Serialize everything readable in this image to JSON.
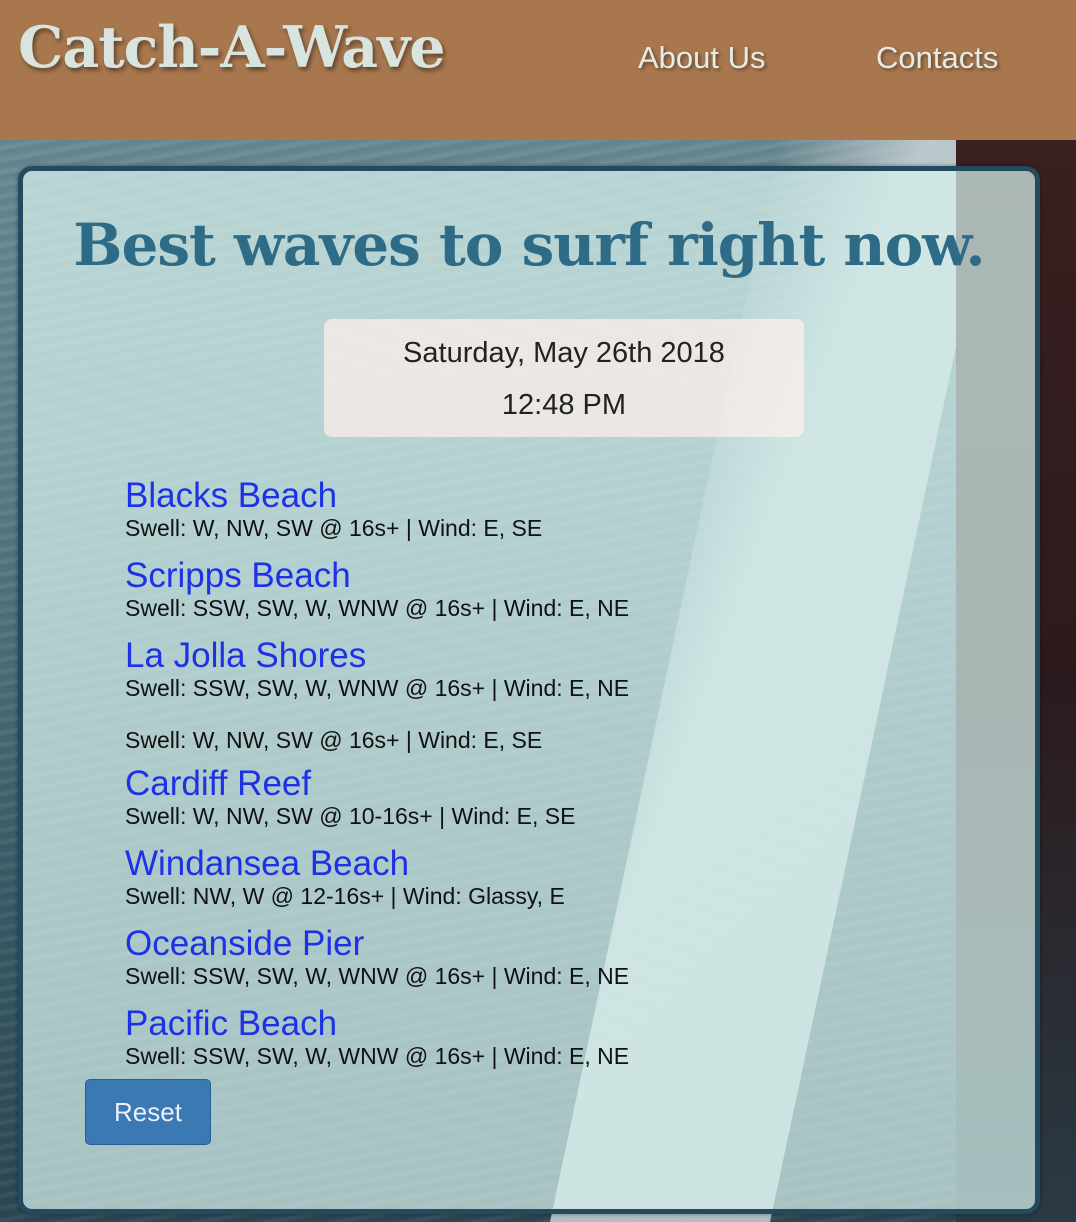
{
  "header": {
    "brand": "Catch-A-Wave",
    "nav": {
      "about": "About Us",
      "contacts": "Contacts"
    }
  },
  "main": {
    "headline": "Best waves to surf right now.",
    "date": "Saturday, May 26th 2018",
    "time": "12:48 PM",
    "spots": [
      {
        "name": "Blacks Beach",
        "detail": "Swell: W, NW, SW @ 16s+ | Wind: E, SE"
      },
      {
        "name": "Scripps Beach",
        "detail": "Swell: SSW, SW, W, WNW @ 16s+ | Wind: E, NE"
      },
      {
        "name": "La Jolla Shores",
        "detail": "Swell: SSW, SW, W, WNW @ 16s+ | Wind: E, NE"
      },
      {
        "name": "",
        "detail": "Swell: W, NW, SW @ 16s+ | Wind: E, SE"
      },
      {
        "name": "Cardiff Reef",
        "detail": "Swell: W, NW, SW @ 10-16s+ | Wind: E, SE"
      },
      {
        "name": "Windansea Beach",
        "detail": "Swell: NW, W @ 12-16s+ | Wind: Glassy, E"
      },
      {
        "name": "Oceanside Pier",
        "detail": "Swell: SSW, SW, W, WNW @ 16s+ | Wind: E, NE"
      },
      {
        "name": "Pacific Beach",
        "detail": "Swell: SSW, SW, W, WNW @ 16s+ | Wind: E, NE"
      }
    ],
    "reset_label": "Reset"
  },
  "colors": {
    "header_bg": "#a8774e",
    "headline": "#2e6b87",
    "link": "#1d31e6",
    "button": "#3b79b5",
    "panel_border": "#234a5e"
  }
}
